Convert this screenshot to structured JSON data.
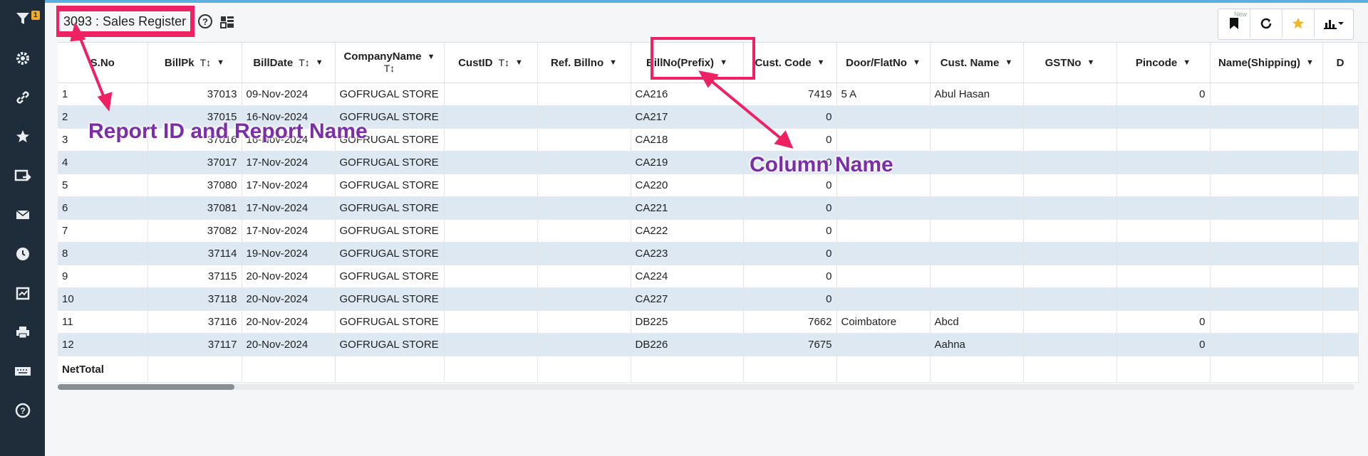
{
  "sidebar": {
    "badge": "1",
    "items": [
      "filter-icon",
      "gear-icon",
      "link-icon",
      "star-icon",
      "export-icon",
      "mail-icon",
      "clock-icon",
      "calendar-icon",
      "print-icon",
      "keyboard-icon",
      "help-icon"
    ]
  },
  "header": {
    "title": "3093 : Sales Register"
  },
  "toolbar": {
    "new_label": "New"
  },
  "columns": [
    "S.No",
    "BillPk",
    "BillDate",
    "CompanyName",
    "CustID",
    "Ref. Billno",
    "BillNo(Prefix)",
    "Cust. Code",
    "Door/FlatNo",
    "Cust. Name",
    "GSTNo",
    "Pincode",
    "Name(Shipping)",
    "D"
  ],
  "rows": [
    [
      "1",
      "37013",
      "09-Nov-2024",
      "GOFRUGAL STORE",
      "",
      "",
      "CA216",
      "7419",
      "5 A",
      "Abul Hasan",
      "",
      "0",
      ""
    ],
    [
      "2",
      "37015",
      "16-Nov-2024",
      "GOFRUGAL STORE",
      "",
      "",
      "CA217",
      "0",
      "",
      "",
      "",
      "",
      ""
    ],
    [
      "3",
      "37016",
      "16-Nov-2024",
      "GOFRUGAL STORE",
      "",
      "",
      "CA218",
      "0",
      "",
      "",
      "",
      "",
      ""
    ],
    [
      "4",
      "37017",
      "17-Nov-2024",
      "GOFRUGAL STORE",
      "",
      "",
      "CA219",
      "0",
      "",
      "",
      "",
      "",
      ""
    ],
    [
      "5",
      "37080",
      "17-Nov-2024",
      "GOFRUGAL STORE",
      "",
      "",
      "CA220",
      "0",
      "",
      "",
      "",
      "",
      ""
    ],
    [
      "6",
      "37081",
      "17-Nov-2024",
      "GOFRUGAL STORE",
      "",
      "",
      "CA221",
      "0",
      "",
      "",
      "",
      "",
      ""
    ],
    [
      "7",
      "37082",
      "17-Nov-2024",
      "GOFRUGAL STORE",
      "",
      "",
      "CA222",
      "0",
      "",
      "",
      "",
      "",
      ""
    ],
    [
      "8",
      "37114",
      "19-Nov-2024",
      "GOFRUGAL STORE",
      "",
      "",
      "CA223",
      "0",
      "",
      "",
      "",
      "",
      ""
    ],
    [
      "9",
      "37115",
      "20-Nov-2024",
      "GOFRUGAL STORE",
      "",
      "",
      "CA224",
      "0",
      "",
      "",
      "",
      "",
      ""
    ],
    [
      "10",
      "37118",
      "20-Nov-2024",
      "GOFRUGAL STORE",
      "",
      "",
      "CA227",
      "0",
      "",
      "",
      "",
      "",
      ""
    ],
    [
      "11",
      "37116",
      "20-Nov-2024",
      "GOFRUGAL STORE",
      "",
      "",
      "DB225",
      "7662",
      "Coimbatore",
      "Abcd",
      "",
      "0",
      ""
    ],
    [
      "12",
      "37117",
      "20-Nov-2024",
      "GOFRUGAL STORE",
      "",
      "",
      "DB226",
      "7675",
      "",
      "Aahna",
      "",
      "0",
      ""
    ]
  ],
  "net_total_label": "NetTotal",
  "annotations": {
    "report_label": "Report ID and Report Name",
    "column_label": "Column Name"
  },
  "colors": {
    "annotation_border": "#ee2163",
    "annotation_text": "#7b2ea8",
    "row_alt": "#dde8f2",
    "sidebar": "#1f2d3a"
  }
}
